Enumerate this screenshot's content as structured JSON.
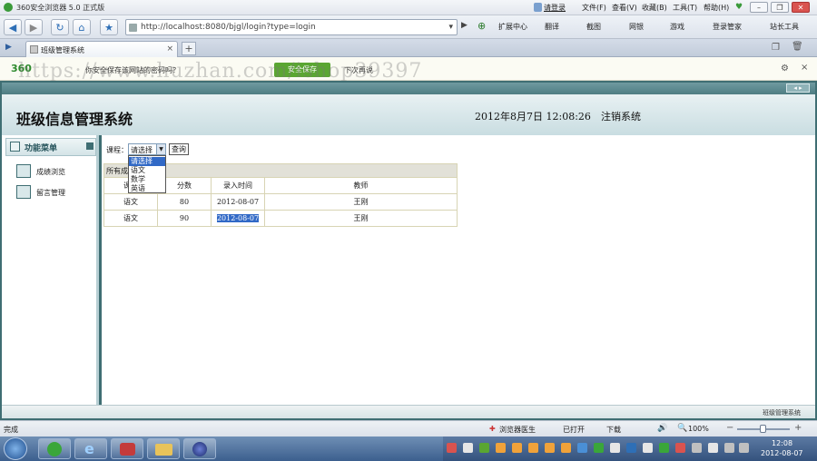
{
  "browser": {
    "title": "360安全浏览器 5.0 正式版",
    "login_link": "请登录",
    "menu": [
      "文件(F)",
      "查看(V)",
      "收藏(B)",
      "工具(T)",
      "帮助(H)"
    ],
    "address": "http://localhost:8080/bjgl/login?type=login",
    "address_host": "localhost",
    "toolbar": [
      "扩展中心",
      "翻译",
      "截图",
      "网银",
      "游戏",
      "登录管家",
      "站长工具"
    ],
    "tab_title": "班级管理系统",
    "info_text": "你安全保存该网站的密码吗？",
    "safe_save": "安全保存",
    "not_now": "下次再说",
    "watermark": "https://www.huzhan.com/ishop39397",
    "status_left": "完成",
    "status_items": [
      "浏览器医生",
      "已打开",
      "下载"
    ],
    "zoom": "100%"
  },
  "app": {
    "title": "班级信息管理系统",
    "datetime": "2012年8月7日  12:08:26",
    "logout": "注销系统",
    "footer": "班级管理系统",
    "sidebar": {
      "header": "功能菜单",
      "items": [
        "成绩浏览",
        "留言管理"
      ]
    },
    "filter": {
      "label": "课程：",
      "selected": "请选择",
      "options": [
        "请选择",
        "语文",
        "数学",
        "英语"
      ],
      "query_button": "查询"
    },
    "table": {
      "caption": "所有成绩",
      "headers": [
        "课程",
        "分数",
        "录入时间",
        "教师"
      ],
      "rows": [
        [
          "语文",
          "80",
          "2012-08-07",
          "王刚"
        ],
        [
          "语文",
          "90",
          "2012-08-07",
          "王刚"
        ]
      ]
    }
  },
  "taskbar": {
    "time": "12:08",
    "date": "2012-08-07"
  },
  "colors": {
    "frame": "#3f6e73",
    "header": "#c9dde1",
    "dropdown_highlight": "#3169c6",
    "safe_button": "#5aa632",
    "taskbar": "#3c5f8e"
  }
}
